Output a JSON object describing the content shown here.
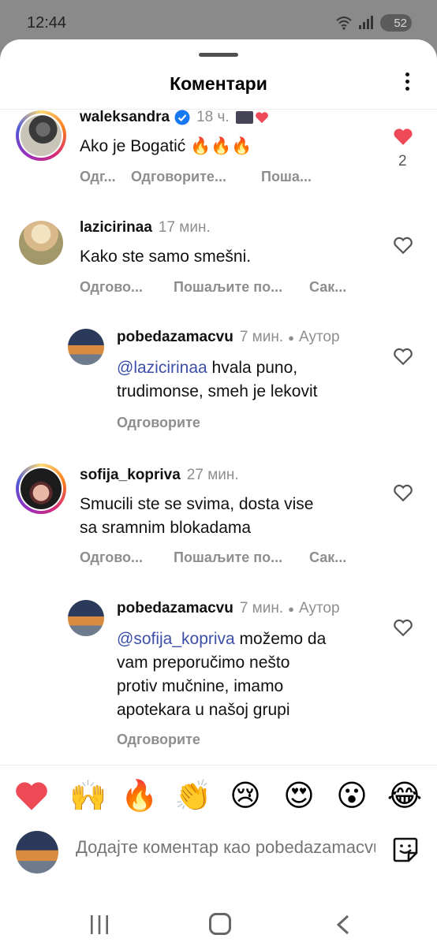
{
  "status_bar": {
    "time": "12:44",
    "battery": "52"
  },
  "sheet": {
    "title": "Коментари"
  },
  "comments": [
    {
      "username": "waleksandra",
      "time": "18 ч.",
      "text": "Ako je Bogatić 🔥🔥🔥",
      "actions": [
        "Одг...",
        "Одговорите...",
        "Поша..."
      ],
      "likes": "2",
      "liked": true
    },
    {
      "username": "lazicirinaa",
      "time": "17 мин.",
      "text": "Kako ste samo smešni.",
      "actions": [
        "Одгово...",
        "Пошаљите по...",
        "Сак..."
      ]
    },
    {
      "username": "pobedazamacvu",
      "time": "7 мин.",
      "author": "Аутор",
      "mention": "@lazicirinaa",
      "text_line1": " hvala puno,",
      "text_line2": "trudimonse, smeh je lekovit",
      "reply_label": "Одговорите"
    },
    {
      "username": "sofija_kopriva",
      "time": "27 мин.",
      "text_line1": "Smucili ste se svima, dosta vise",
      "text_line2": "sa sramnim blokadama",
      "actions": [
        "Одгово...",
        "Пошаљите по...",
        "Сак..."
      ]
    },
    {
      "username": "pobedazamacvu",
      "time": "7 мин.",
      "author": "Аутор",
      "mention": "@sofija_kopriva",
      "text_line1": " možemo da",
      "text_line2": "vam preporučimo nešto",
      "text_line3": "protiv mučnine, imamo",
      "text_line4": "apotekara u našoj grupi",
      "reply_label": "Одговорите"
    }
  ],
  "emoji_bar": [
    "❤",
    "🙌",
    "🔥",
    "👏",
    "😢",
    "😍",
    "😮",
    "😂"
  ],
  "composer": {
    "placeholder": "Додајте коментар као pobedazamacvu"
  },
  "colors": {
    "like_red": "#ed4956",
    "mention_blue": "#3c4ea8",
    "secondary_text": "#8e8e8e"
  }
}
